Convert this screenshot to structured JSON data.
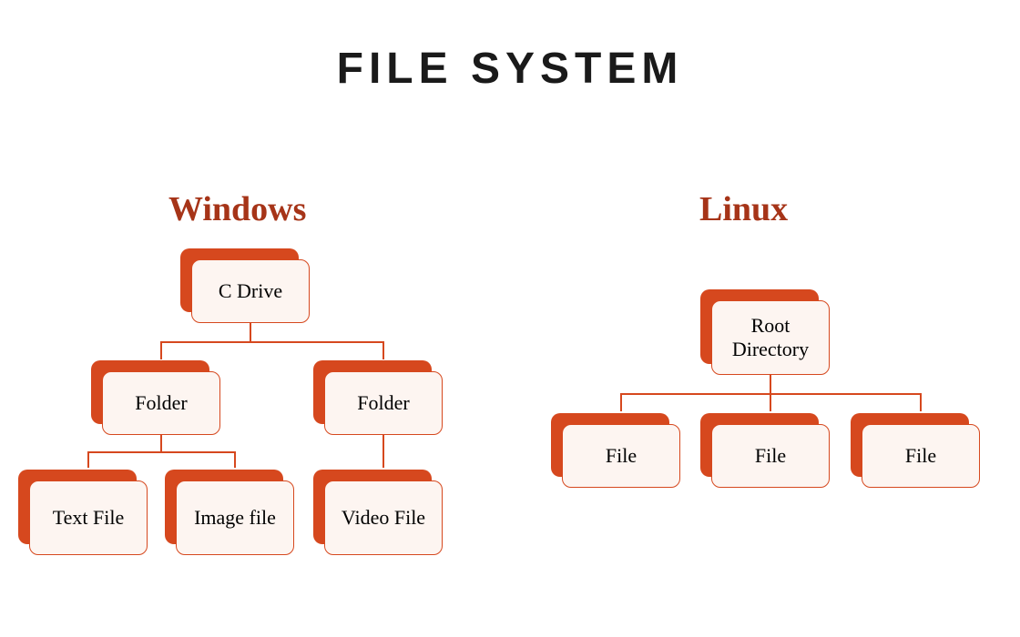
{
  "title": "FILE SYSTEM",
  "windows": {
    "heading": "Windows",
    "root": "C Drive",
    "folder1": "Folder",
    "folder2": "Folder",
    "leaf1": "Text File",
    "leaf2": "Image file",
    "leaf3": "Video File"
  },
  "linux": {
    "heading": "Linux",
    "root": "Root Directory",
    "leaf1": "File",
    "leaf2": "File",
    "leaf3": "File"
  }
}
